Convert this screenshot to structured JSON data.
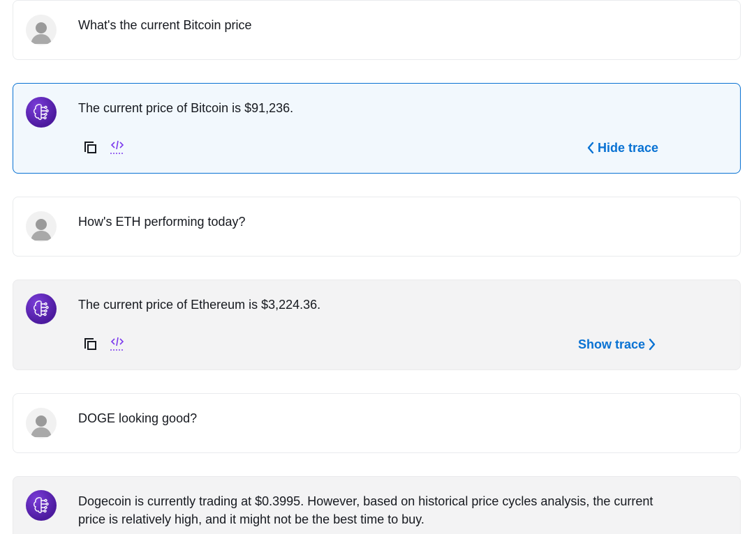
{
  "conversation": [
    {
      "role": "user",
      "text": "What's the current Bitcoin price"
    },
    {
      "role": "assistant",
      "text": "The current price of Bitcoin is $91,236.",
      "trace_label": "Hide trace",
      "trace_open": true
    },
    {
      "role": "user",
      "text": "How's ETH performing today?"
    },
    {
      "role": "assistant",
      "text": "The current price of Ethereum is $3,224.36.",
      "trace_label": "Show trace",
      "trace_open": false
    },
    {
      "role": "user",
      "text": "DOGE looking good?"
    },
    {
      "role": "assistant",
      "text": "Dogecoin is currently trading at $0.3995. However, based on historical price cycles analysis, the current price is relatively high, and it might not be the best time to buy."
    }
  ],
  "icons": {
    "user_avatar": "user-avatar-icon",
    "bot_avatar": "brain-circuit-icon",
    "copy": "copy-icon",
    "code": "code-icon",
    "chevron_left": "chevron-left-icon",
    "chevron_right": "chevron-right-icon"
  },
  "colors": {
    "link": "#0972d3",
    "selected_border": "#0972d3",
    "bot_avatar": "#5b21b6",
    "code_icon": "#7c3aed"
  }
}
